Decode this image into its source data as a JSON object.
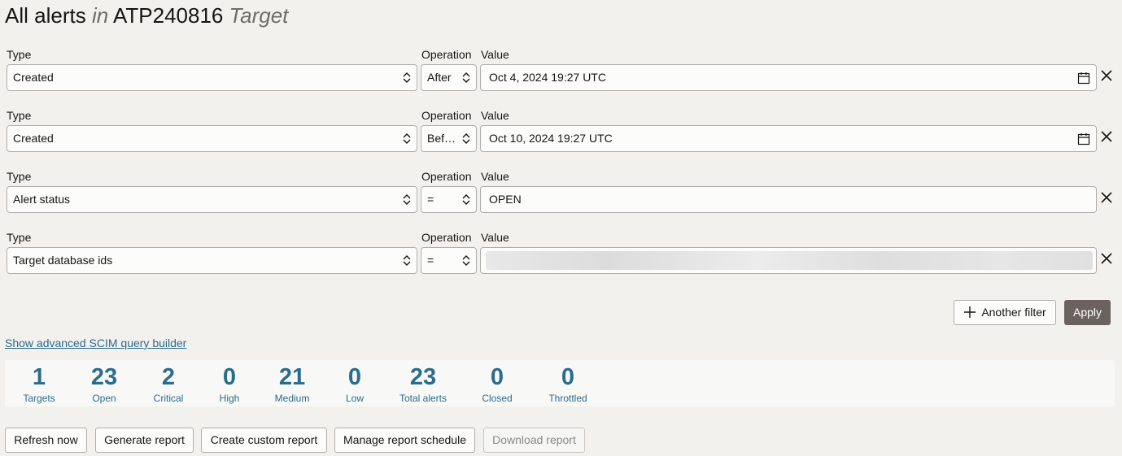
{
  "header": {
    "title_prefix": "All alerts",
    "title_in": "in",
    "title_target": "ATP240816",
    "title_suffix": "Target"
  },
  "filter_labels": {
    "type": "Type",
    "operation": "Operation",
    "value": "Value"
  },
  "filters": [
    {
      "type": "Created",
      "operation": "After",
      "value": "Oct 4, 2024 19:27 UTC",
      "has_calendar": true
    },
    {
      "type": "Created",
      "operation": "Bef…",
      "value": "Oct 10, 2024 19:27 UTC",
      "has_calendar": true
    },
    {
      "type": "Alert status",
      "operation": "=",
      "value": "OPEN",
      "has_calendar": false
    },
    {
      "type": "Target database ids",
      "operation": "=",
      "value": "",
      "value_redacted": true,
      "has_calendar": false
    }
  ],
  "actions": {
    "another_filter": "Another filter",
    "apply": "Apply"
  },
  "advanced_link": "Show advanced SCIM query builder",
  "stats": [
    {
      "value": "1",
      "label": "Targets"
    },
    {
      "value": "23",
      "label": "Open"
    },
    {
      "value": "2",
      "label": "Critical"
    },
    {
      "value": "0",
      "label": "High"
    },
    {
      "value": "21",
      "label": "Medium"
    },
    {
      "value": "0",
      "label": "Low"
    },
    {
      "value": "23",
      "label": "Total alerts"
    },
    {
      "value": "0",
      "label": "Closed"
    },
    {
      "value": "0",
      "label": "Throttled"
    }
  ],
  "toolbar": {
    "refresh": "Refresh now",
    "generate": "Generate report",
    "create_custom": "Create custom report",
    "manage_schedule": "Manage report schedule",
    "download": "Download report"
  },
  "colors": {
    "accent": "#2a6c8d",
    "link": "#2b6a8f",
    "primary_button": "#6b625f",
    "background": "#f2f1ee"
  }
}
